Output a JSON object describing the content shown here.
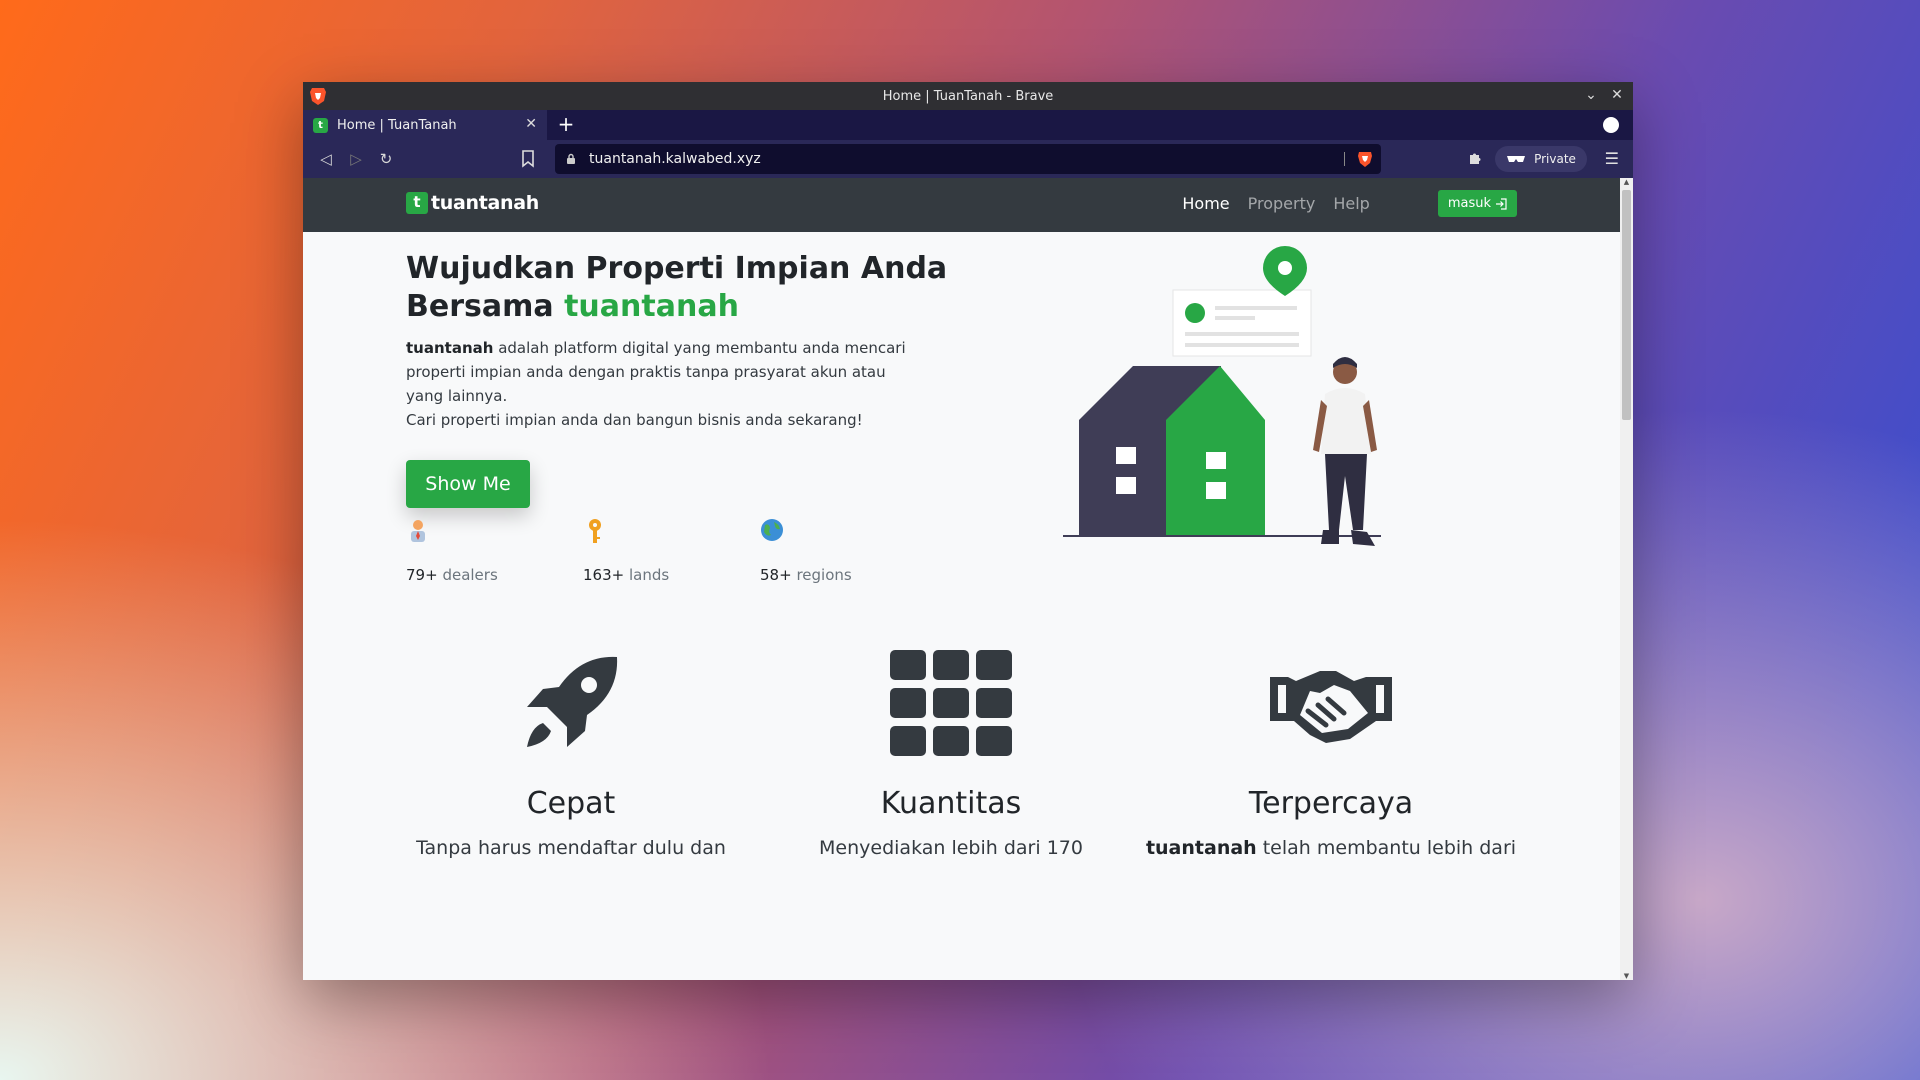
{
  "window": {
    "title": "Home | TuanTanah - Brave"
  },
  "tab": {
    "title": "Home | TuanTanah",
    "favicon_letter": "t"
  },
  "toolbar": {
    "url": "tuantanah.kalwabed.xyz",
    "private_label": "Private"
  },
  "site": {
    "logo_letter": "t",
    "logo_text": "tuantanah",
    "nav": {
      "home": "Home",
      "property": "Property",
      "help": "Help",
      "login": "masuk"
    },
    "hero": {
      "title_line1": "Wujudkan Properti Impian Anda",
      "title_line2_prefix": "Bersama",
      "title_brand": "tuantanah",
      "desc_brand": "tuantanah",
      "desc_rest": "adalah platform digital yang membantu anda mencari properti impian anda dengan praktis tanpa prasyarat akun atau yang lainnya.",
      "desc_line2": "Cari properti impian anda dan bangun bisnis anda sekarang!",
      "cta": "Show Me"
    },
    "stats": [
      {
        "value": "79+",
        "unit": "dealers",
        "icon": "dealer-icon"
      },
      {
        "value": "163+",
        "unit": "lands",
        "icon": "key-icon"
      },
      {
        "value": "58+",
        "unit": "regions",
        "icon": "globe-icon"
      }
    ],
    "features": [
      {
        "title": "Cepat",
        "desc_brand": "",
        "desc": "Tanpa harus mendaftar dulu dan",
        "icon": "rocket-icon"
      },
      {
        "title": "Kuantitas",
        "desc_brand": "",
        "desc": "Menyediakan lebih dari 170",
        "icon": "grid-icon"
      },
      {
        "title": "Terpercaya",
        "desc_brand": "tuantanah",
        "desc": " telah membantu lebih dari",
        "icon": "handshake-icon"
      }
    ]
  },
  "colors": {
    "brand_green": "#28a745",
    "nav_dark": "#343a40",
    "browser_tab": "#2a2858"
  }
}
